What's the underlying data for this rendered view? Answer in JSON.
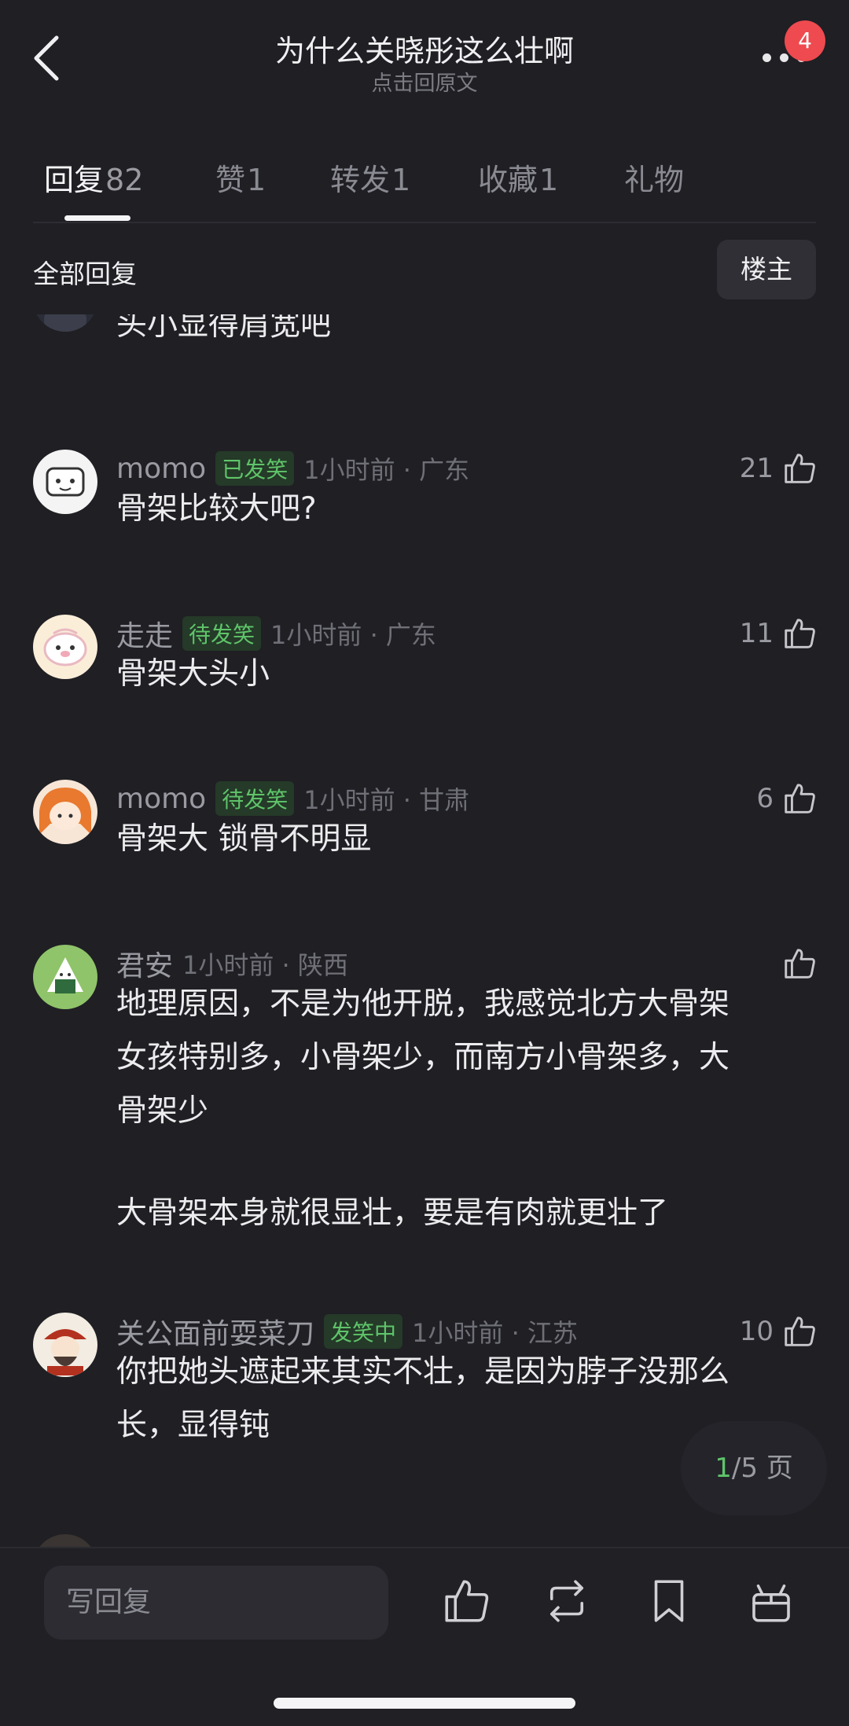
{
  "header": {
    "title": "为什么关晓彤这么壮啊",
    "subtitle": "点击回原文",
    "badge": "4",
    "back_icon": "chevron-left-icon",
    "more_icon": "more-dots-icon"
  },
  "tabs": [
    {
      "label": "回复",
      "count": "82"
    },
    {
      "label": "赞",
      "count": "1"
    },
    {
      "label": "转发",
      "count": "1"
    },
    {
      "label": "收藏",
      "count": "1"
    },
    {
      "label": "礼物",
      "count": ""
    }
  ],
  "section": {
    "title": "全部回复",
    "op_button": "楼主"
  },
  "comments": [
    {
      "content": "头小显得肩宽吧"
    },
    {
      "user": "momo",
      "tag": "已发笑",
      "time_loc": "1小时前 · 广东",
      "likes": "21",
      "content": "骨架比较大吧?"
    },
    {
      "user": "走走",
      "tag": "待发笑",
      "time_loc": "1小时前 · 广东",
      "likes": "11",
      "content": "骨架大头小"
    },
    {
      "user": "momo",
      "tag": "待发笑",
      "time_loc": "1小时前 · 甘肃",
      "likes": "6",
      "content": "骨架大 锁骨不明显"
    },
    {
      "user": "君安",
      "time_loc": "1小时前 · 陕西",
      "likes": "",
      "content_lines": [
        "地理原因，不是为他开脱，我感觉北方大骨架",
        "女孩特别多，小骨架少，而南方小骨架多，大",
        "骨架少",
        "",
        "大骨架本身就很显壮，要是有肉就更壮了"
      ]
    },
    {
      "user": "关公面前耍菜刀",
      "tag": "发笑中",
      "time_loc": "1小时前 · 江苏",
      "likes": "10",
      "content_lines": [
        "你把她头遮起来其实不壮，是因为脖子没那么",
        "长，显得钝"
      ]
    }
  ],
  "pager": {
    "current": "1",
    "rest": "/5 页"
  },
  "bottom": {
    "reply_placeholder": "写回复",
    "icons": [
      "thumbs-up-icon",
      "repost-icon",
      "bookmark-icon",
      "gift-icon"
    ]
  },
  "colors": {
    "background": "#1f1f24",
    "accent_green": "#5fc46a",
    "badge_red": "#ee4a4f"
  }
}
